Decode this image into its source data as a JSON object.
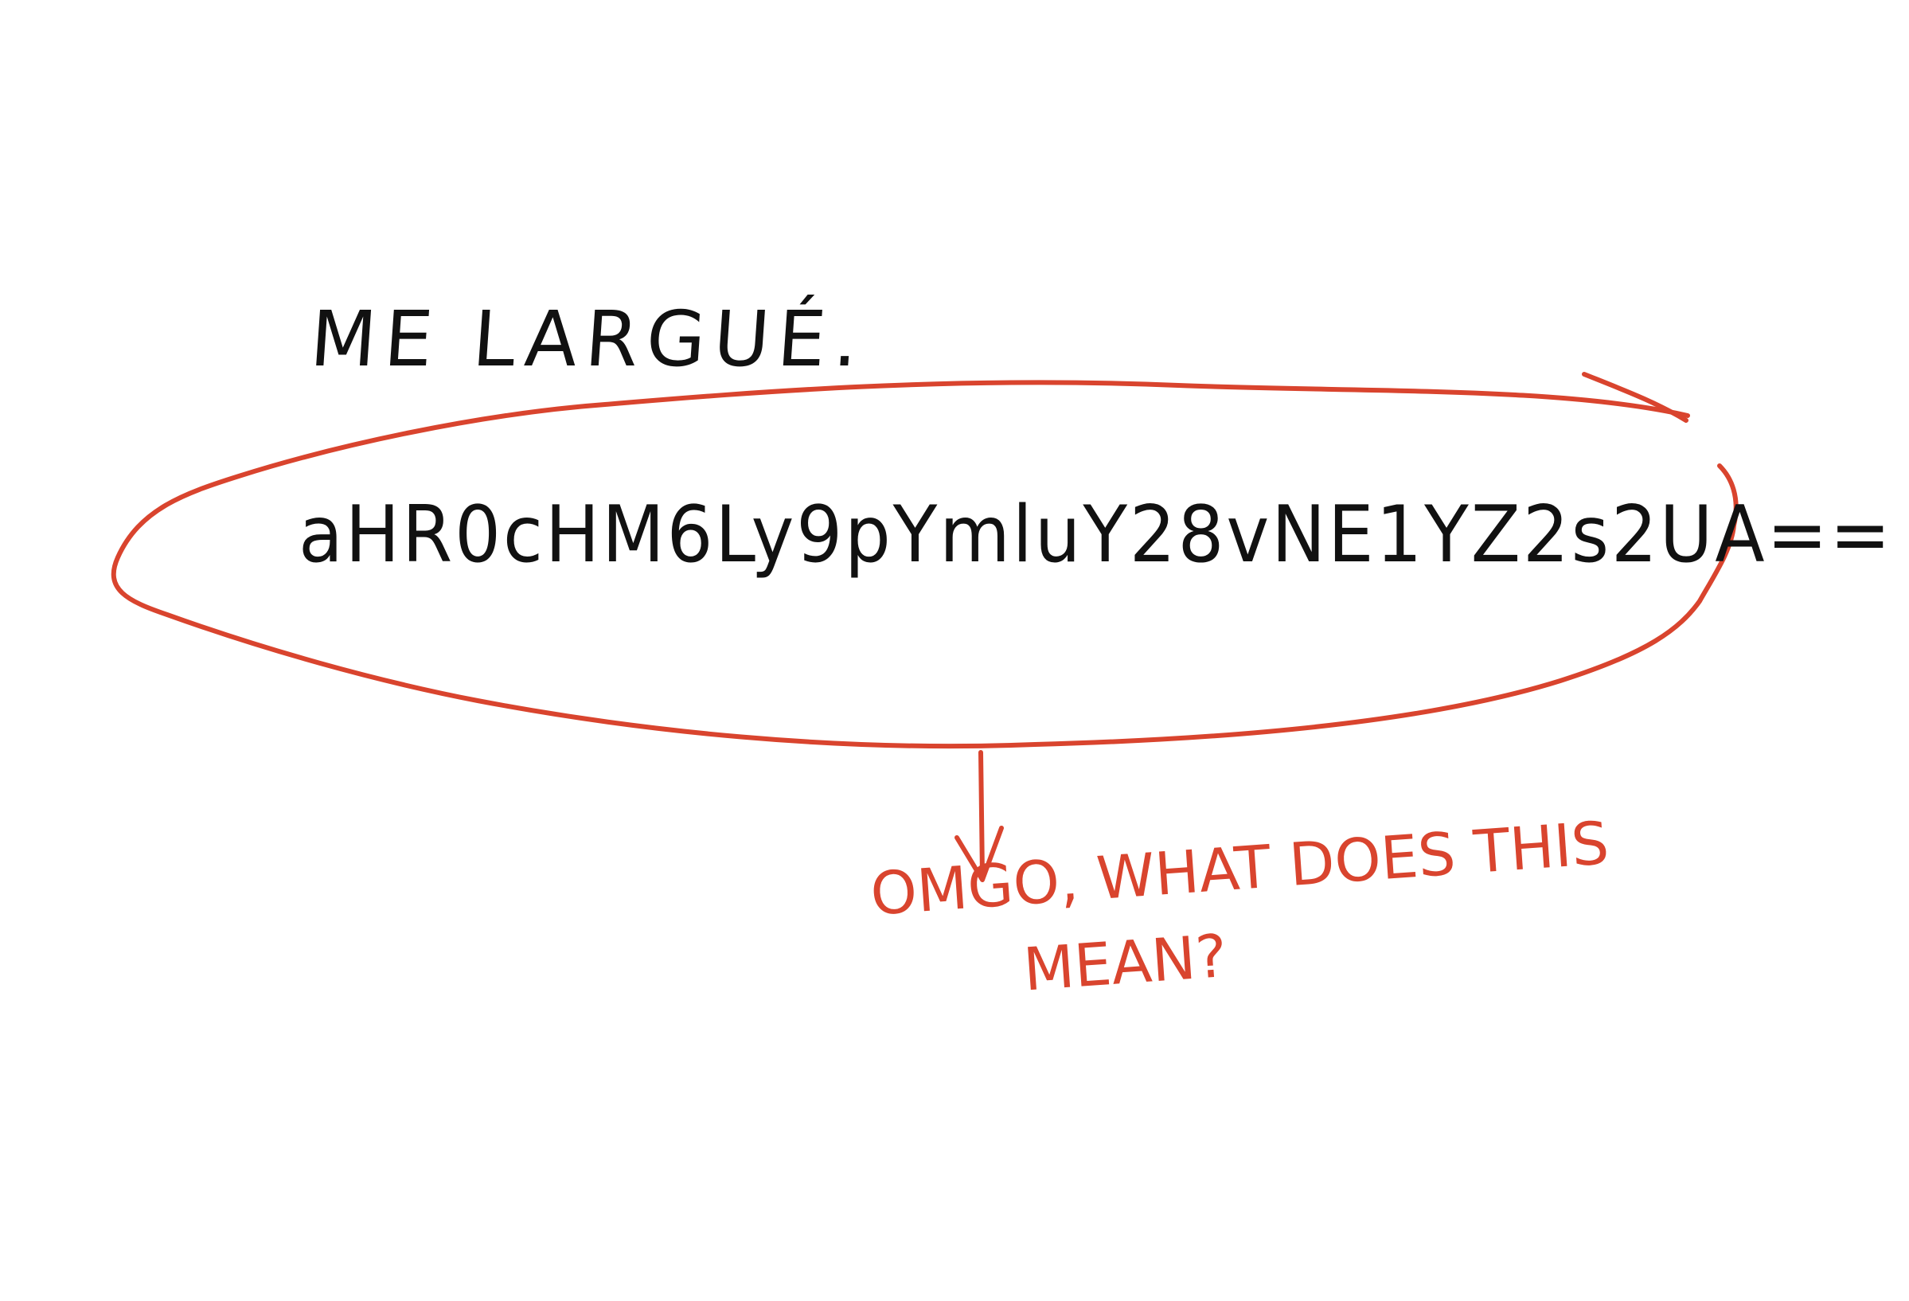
{
  "note": {
    "heading": "ME LARGUÉ.",
    "encoded_line": "aHR0cHM6Ly9pYmluY28vNE1YZ2s2UA==",
    "question_line1": "OMGO, WHAT DOES THIS",
    "question_line2": "MEAN?"
  },
  "colors": {
    "background": "#ffffff",
    "ink": "#111111",
    "annotation": "#d9442e"
  }
}
